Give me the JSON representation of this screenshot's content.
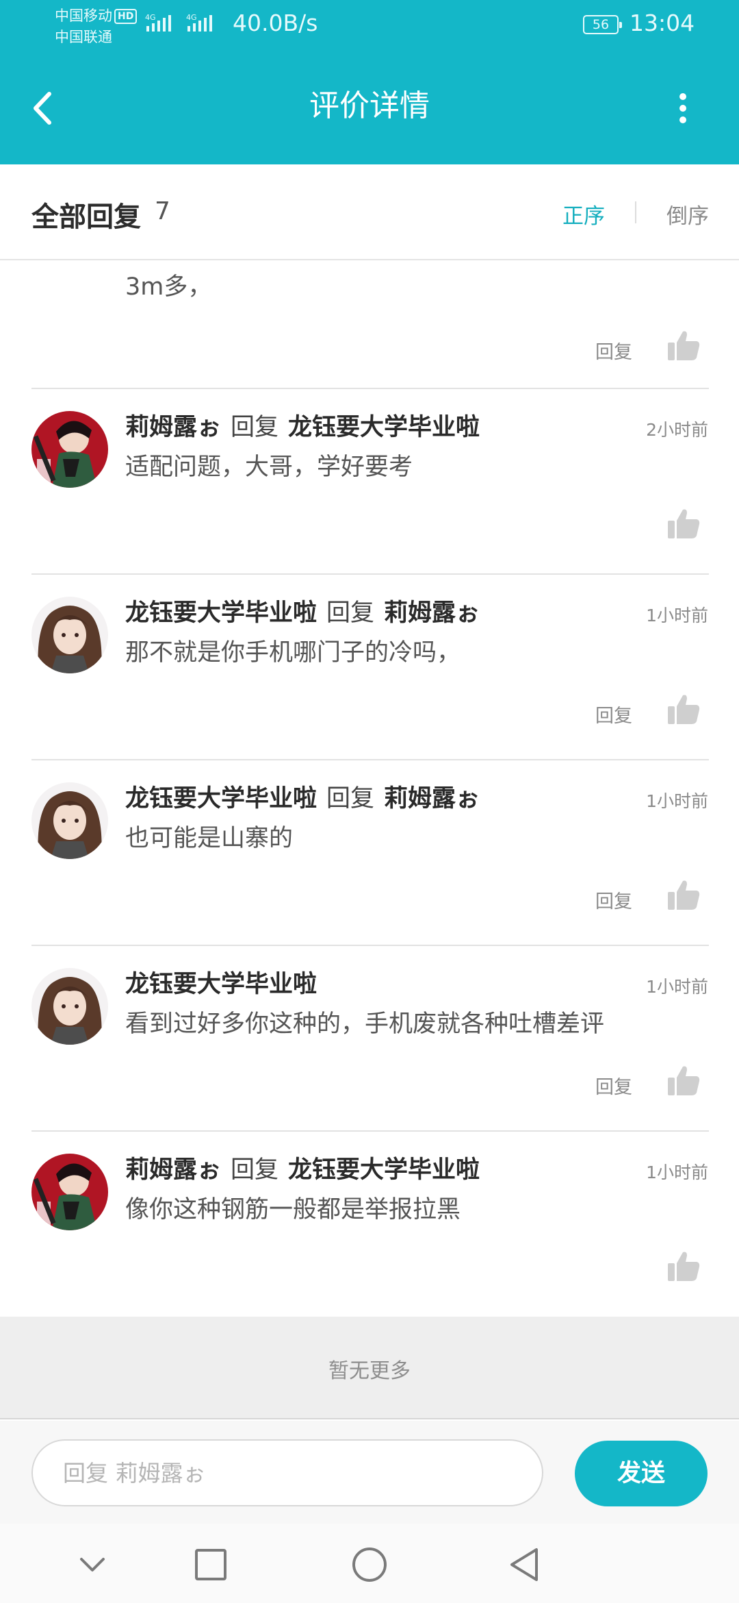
{
  "status_bar": {
    "carrier_1": "中国移动",
    "hd_badge": "HD",
    "carrier_2": "中国联通",
    "network_1": "4G",
    "network_2": "4G",
    "net_speed": "40.0B/s",
    "battery": "56",
    "time": "13:04"
  },
  "app_bar": {
    "title": "评价详情"
  },
  "reply_header": {
    "title": "全部回复",
    "count": "7",
    "sort_asc": "正序",
    "sort_desc": "倒序"
  },
  "partial_comment": {
    "text": "3m多，",
    "reply_label": "回复"
  },
  "comments": [
    {
      "author": "莉姆露ぉ",
      "verb": "回复",
      "target": "龙钰要大学毕业啦",
      "time": "2小时前",
      "text": "适配问题，大哥，学好要考",
      "avatar": "red-haired",
      "reply_label": ""
    },
    {
      "author": "龙钰要大学毕业啦",
      "verb": "回复",
      "target": "莉姆露ぉ",
      "time": "1小时前",
      "text": "那不就是你手机哪门子的冷吗，",
      "avatar": "brown-haired",
      "reply_label": "回复"
    },
    {
      "author": "龙钰要大学毕业啦",
      "verb": "回复",
      "target": "莉姆露ぉ",
      "time": "1小时前",
      "text": "也可能是山寨的",
      "avatar": "brown-haired",
      "reply_label": "回复"
    },
    {
      "author": "龙钰要大学毕业啦",
      "verb": "",
      "target": "",
      "time": "1小时前",
      "text": "看到过好多你这种的，手机废就各种吐槽差评",
      "avatar": "brown-haired",
      "reply_label": "回复"
    },
    {
      "author": "莉姆露ぉ",
      "verb": "回复",
      "target": "龙钰要大学毕业啦",
      "time": "1小时前",
      "text": "像你这种钢筋一般都是举报拉黑",
      "avatar": "red-haired",
      "reply_label": ""
    }
  ],
  "footer": {
    "no_more": "暂无更多"
  },
  "input_bar": {
    "placeholder": "回复 莉姆露ぉ",
    "send_label": "发送"
  },
  "nav_bar": {
    "buttons": [
      "chevron-down-icon",
      "square-icon",
      "circle-home-icon",
      "triangle-back-icon"
    ]
  },
  "colors": {
    "accent": "#14b7c8",
    "sort_active": "#14aebe",
    "text_muted": "#8a8a8a"
  }
}
